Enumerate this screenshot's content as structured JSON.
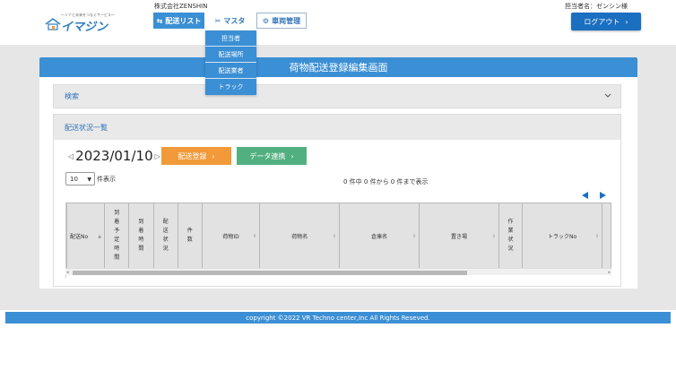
{
  "header": {
    "logo_tiny": "～ミナと未来をつなぐサービス～",
    "logo_brand": "イマジン",
    "company": "株式会社ZENSHIN",
    "user": "担当者名：ゼンシン様",
    "logout": "ログアウト",
    "nav": {
      "delivery": "配送リスト",
      "master": "マスタ",
      "vehicle": "車両管理"
    }
  },
  "dropdown": [
    "担当者",
    "配送場所",
    "配送業者",
    "トラック"
  ],
  "page_title": "荷物配送登録編集画面",
  "search_label": "検索",
  "list_label": "配送状況一覧",
  "date": "2023/01/10",
  "buttons": {
    "register": "配送登録",
    "data_link": "データ連携"
  },
  "page_size": "10",
  "page_suffix": "件表示",
  "info": "0 件中 0 件から 0 件まで表示",
  "table_headers": [
    {
      "label": "配送No",
      "sort": "▲"
    },
    {
      "label": "到着予定時間"
    },
    {
      "label": "到着時間"
    },
    {
      "label": "配送状況"
    },
    {
      "label": "件数"
    },
    {
      "label": "荷物ID",
      "sort": "⇕"
    },
    {
      "label": "荷物名",
      "sort": "⇕"
    },
    {
      "label": "倉庫名",
      "sort": "⇕"
    },
    {
      "label": "置き場",
      "sort": "⇕"
    },
    {
      "label": "作業状況"
    },
    {
      "label": "トラックNo",
      "sort": "⇕"
    },
    {
      "label": ""
    }
  ],
  "footer": "copyright ©2022 VR Techno center,Inc All Rights Reseved.",
  "colors": {
    "primary": "#3b8fd4",
    "dark_blue": "#1a6fc1",
    "orange": "#f29a3a",
    "green": "#52b080"
  }
}
